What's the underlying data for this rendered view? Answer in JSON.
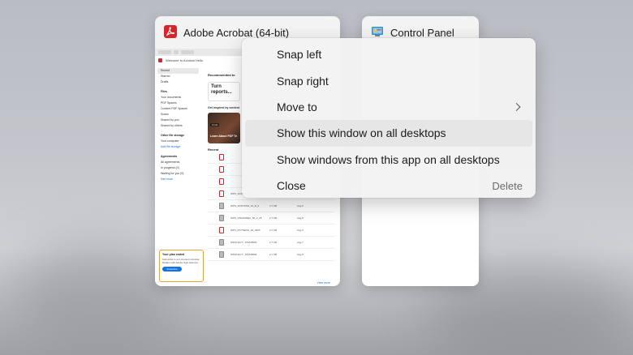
{
  "windows": [
    {
      "title": "Adobe Acrobat (64-bit)",
      "icon": "adobe-acrobat-icon",
      "content": {
        "tab_labels": [
          "Home",
          "Create"
        ],
        "welcome": "Welcome to Acrobat Hello",
        "sidebar": {
          "items": [
            "Recent",
            "Starred",
            "Drafts"
          ],
          "files_heading": "Files",
          "files_items": [
            "Your documents",
            "PDF Spaces",
            "Content PDF Spaces",
            "Scans",
            "Shared by you",
            "Shared by others"
          ],
          "storage_heading": "Other file storage",
          "storage_items": [
            "Your computer"
          ],
          "storage_link": "Add file storage",
          "agreements_heading": "Agreements",
          "agreements_items": [
            "All agreements",
            "In progress (0)",
            "Waiting for you (0)"
          ],
          "agreements_link": "See more"
        },
        "plan": {
          "title": "Your plan ended",
          "text": "Subscribe to our premium Acrobat Reader with Adobe Sign features",
          "button": "Subscribe"
        },
        "main": {
          "recommended_heading": "Recommended to",
          "rec_card": "Turn reports...",
          "inspired_heading": "Get inspired by content",
          "inspired_badge": "3 min",
          "inspired_text": "Learn About PDF Te",
          "recent_heading": "Recent",
          "files": [
            {
              "name": "",
              "size": "",
              "date": "",
              "type": "pdf"
            },
            {
              "name": "",
              "size": "",
              "date": "",
              "type": "pdf"
            },
            {
              "name": "",
              "size": "",
              "date": "",
              "type": "pdf"
            },
            {
              "name": "WPS_SCREENSH_26_2_1",
              "size": "27.5 KB",
              "date": "Aug 9",
              "type": "pdf"
            },
            {
              "name": "WPS_SOFT1001_10_E_0",
              "size": "2.7 KB",
              "date": "Aug 9",
              "type": "img"
            },
            {
              "name": "WPS_STEAMDEC_56_2_25",
              "size": "2.7 KB",
              "date": "Aug 8",
              "type": "img"
            },
            {
              "name": "WPS_PFITNESS_84_2025",
              "size": "2.7 KB",
              "date": "Aug 9",
              "type": "pdf"
            },
            {
              "name": "WIKIP ECT - P2VP8809",
              "size": "2.7 KB",
              "date": "Aug 7",
              "type": "img"
            },
            {
              "name": "WIKIP ECT - P2VP8809",
              "size": "2.7 KB",
              "date": "Aug 8",
              "type": "img"
            }
          ],
          "view_more": "View more"
        }
      }
    },
    {
      "title": "Control Panel",
      "icon": "control-panel-icon"
    }
  ],
  "context_menu": {
    "items": [
      {
        "label": "Snap left"
      },
      {
        "label": "Snap right"
      },
      {
        "label": "Move to",
        "submenu": true
      },
      {
        "label": "Show this window on all desktops",
        "highlighted": true
      },
      {
        "label": "Show windows from this app on all desktops"
      },
      {
        "label": "Close",
        "shortcut": "Delete"
      }
    ]
  },
  "colors": {
    "acrobat_red": "#d4262b",
    "link_blue": "#1473e6",
    "plan_border": "#e8a33b",
    "menu_bg": "#f3f3f3",
    "menu_hover": "#e6e6e6"
  }
}
